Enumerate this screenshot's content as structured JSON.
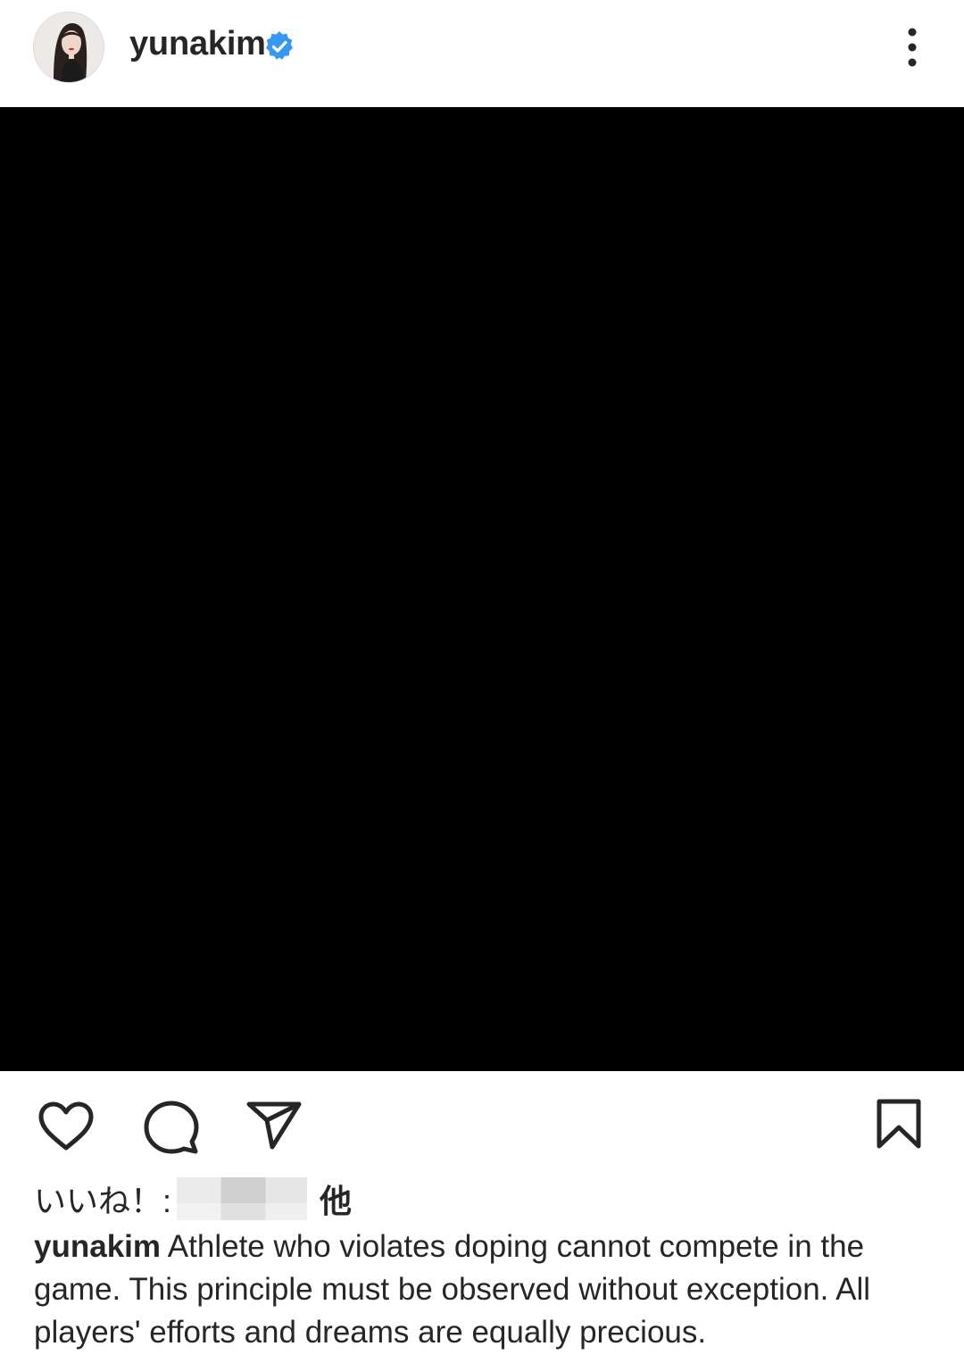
{
  "post": {
    "username": "yunakim",
    "verified": true,
    "likes_prefix": "いいね！: ",
    "likes_suffix": "他",
    "caption_user": "yunakim",
    "caption_text": "Athlete who violates doping cannot compete in the game. This principle must be observed without exception. All players' efforts and dreams are equally precious."
  },
  "icons": {
    "verified": "verified-badge-icon",
    "more": "more-options-icon",
    "like": "heart-icon",
    "comment": "comment-icon",
    "share": "send-icon",
    "save": "bookmark-icon"
  },
  "colors": {
    "text": "#262626",
    "verified": "#3897f0",
    "media_background": "#000000"
  }
}
